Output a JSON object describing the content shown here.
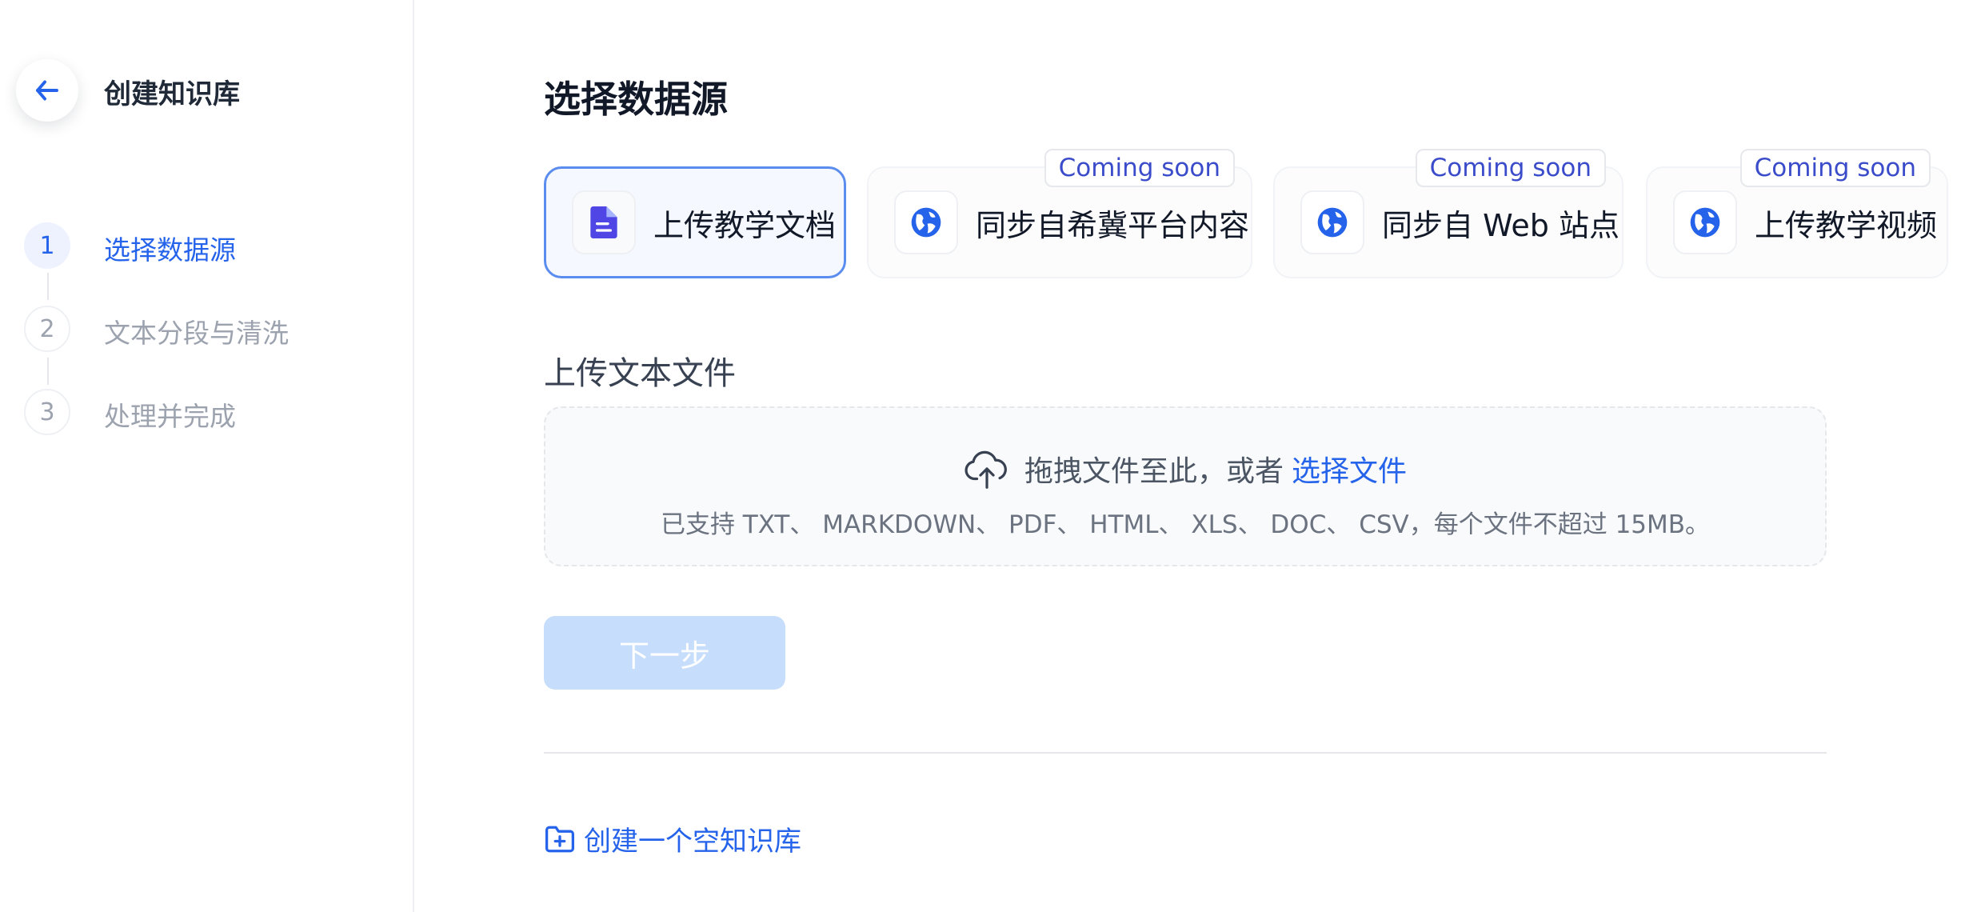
{
  "sidebar": {
    "title": "创建知识库",
    "steps": [
      {
        "number": "1",
        "label": "选择数据源"
      },
      {
        "number": "2",
        "label": "文本分段与清洗"
      },
      {
        "number": "3",
        "label": "处理并完成"
      }
    ]
  },
  "main": {
    "title": "选择数据源",
    "sources": [
      {
        "label": "上传教学文档",
        "icon": "document-icon",
        "badge": ""
      },
      {
        "label": "同步自希冀平台内容",
        "icon": "globe-icon",
        "badge": "Coming soon"
      },
      {
        "label": "同步自 Web 站点",
        "icon": "globe-icon",
        "badge": "Coming soon"
      },
      {
        "label": "上传教学视频",
        "icon": "globe-icon",
        "badge": "Coming soon"
      }
    ],
    "upload": {
      "section_title": "上传文本文件",
      "drag_text": "拖拽文件至此，或者",
      "select_link": "选择文件",
      "supported_text": "已支持 TXT、 MARKDOWN、 PDF、 HTML、 XLS、 DOC、 CSV，每个文件不超过 15MB。"
    },
    "next_button": "下一步",
    "create_empty": "创建一个空知识库"
  },
  "colors": {
    "accent": "#2563eb",
    "selected_border": "#5b8def",
    "disabled_button": "#c6ddfb",
    "badge_text": "#3b4cca"
  }
}
